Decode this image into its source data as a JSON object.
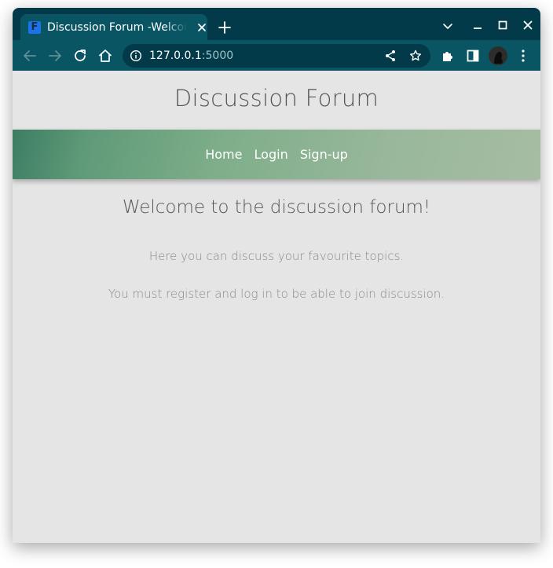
{
  "browser": {
    "tab_title": "Discussion Forum -Welcome",
    "favicon_letter": "F",
    "url_host": "127.0.0.1",
    "url_port": ":5000"
  },
  "site": {
    "title": "Discussion Forum",
    "nav": [
      "Home",
      "Login",
      "Sign-up"
    ],
    "welcome_heading": "Welcome to the discussion forum!",
    "paragraphs": [
      "Here you can discuss your favourite topics.",
      "You must register and log in to be able to join discussion."
    ]
  },
  "colors": {
    "tabstrip": "#033a49",
    "toolbar": "#0a5563",
    "page_bg": "#e5e5e5",
    "nav_gradient_start": "#3c7d63",
    "nav_gradient_end": "#a6bda3"
  }
}
